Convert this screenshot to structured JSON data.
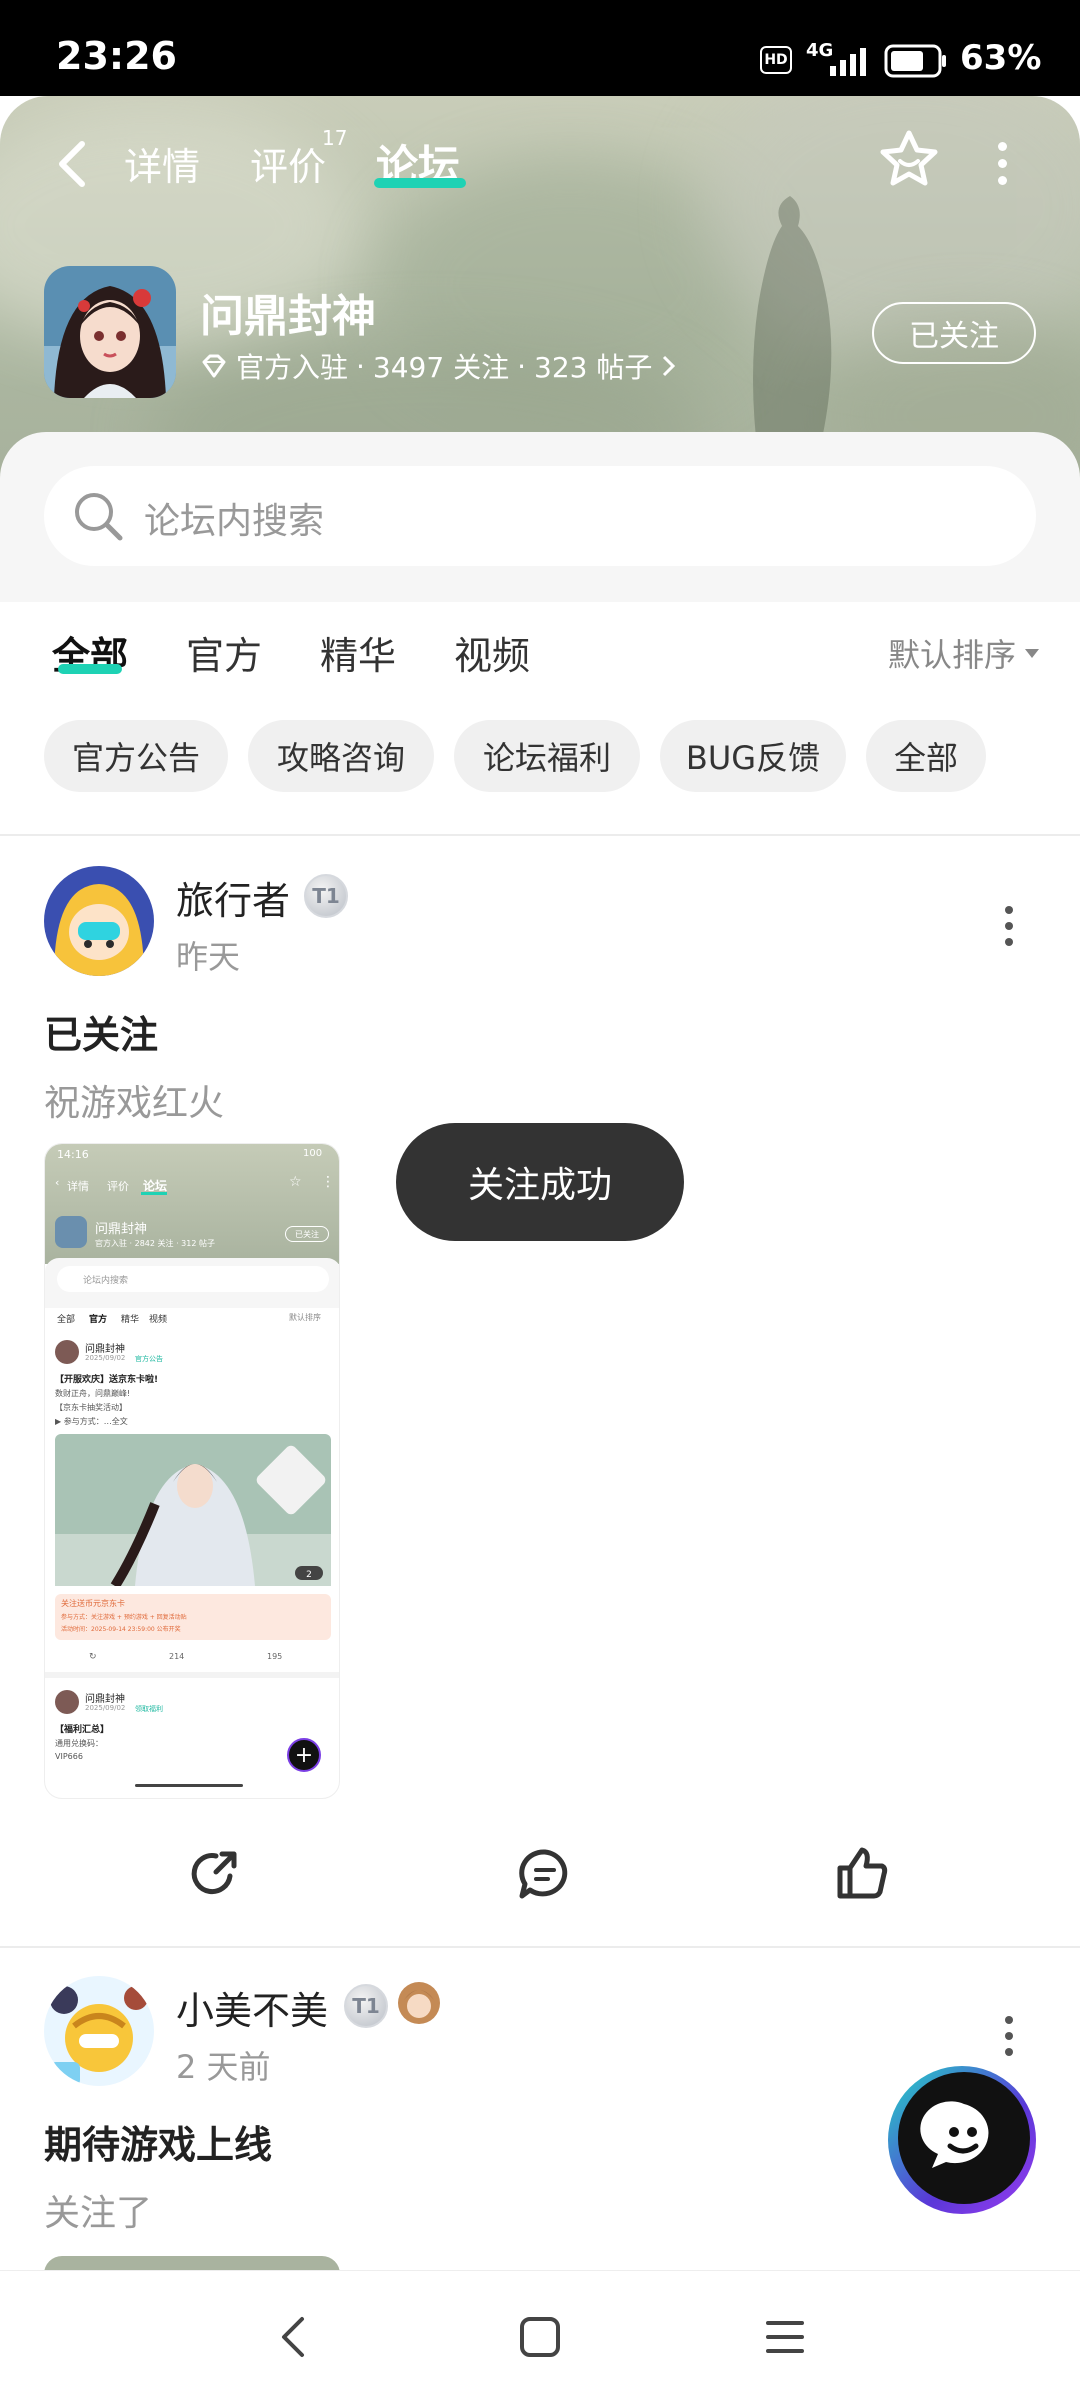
{
  "status": {
    "time": "23:26",
    "hd": "HD",
    "net": "4G",
    "battery": "63%"
  },
  "topnav": {
    "tabs": [
      {
        "label": "详情"
      },
      {
        "label": "评价",
        "count": "17"
      },
      {
        "label": "论坛"
      }
    ]
  },
  "game": {
    "name": "问鼎封神",
    "official": "官方入驻",
    "followers": "3497 关注",
    "posts": "323 帖子",
    "sep": "·",
    "follow_label": "已关注"
  },
  "search": {
    "placeholder": "论坛内搜索"
  },
  "filter": {
    "tabs": [
      {
        "label": "全部"
      },
      {
        "label": "官方"
      },
      {
        "label": "精华"
      },
      {
        "label": "视频"
      }
    ],
    "sort": "默认排序"
  },
  "chips": [
    {
      "label": "官方公告"
    },
    {
      "label": "攻略咨询"
    },
    {
      "label": "论坛福利"
    },
    {
      "label": "BUG反馈"
    },
    {
      "label": "全部"
    }
  ],
  "posts": [
    {
      "user": "旅行者",
      "level": "T1",
      "time": "昨天",
      "title": "已关注",
      "body": "祝游戏红火"
    },
    {
      "user": "小美不美",
      "level": "T1",
      "time": "2 天前",
      "title": "期待游戏上线",
      "body": "关注了"
    }
  ],
  "toast": "关注成功",
  "thumb": {
    "time": "14:16",
    "battery": "100",
    "tabs": [
      "详情",
      "评价",
      "论坛"
    ],
    "game": "问鼎封神",
    "meta": "官方入驻 · 2842 关注 · 312 帖子",
    "follow": "已关注",
    "search": "论坛内搜索",
    "ftabs": [
      "全部",
      "官方",
      "精华",
      "视频"
    ],
    "sort": "默认排序",
    "post1": {
      "name": "问鼎封神",
      "date": "2025/09/02",
      "tag": "官方公告",
      "lines": [
        "【开服欢庆】送京东卡啦!",
        "数财正舟，问鼎巅峰!",
        "【京东卡抽奖活动】",
        "▶ 参与方式：…全文"
      ],
      "img_count": "2",
      "banner_title": "关注送币元京东卡",
      "banner_lines": [
        "参与方式：关注游戏 + 预约游戏 + 回复活动贴",
        "活动时间：2025-09-14 23:59:00 公布开奖"
      ],
      "comments": "214",
      "likes": "195"
    },
    "post2": {
      "name": "问鼎封神",
      "date": "2025/09/02",
      "tag": "领取福利",
      "lines": [
        "【福利汇总】",
        "通用兑换码：",
        "VIP666"
      ]
    }
  }
}
